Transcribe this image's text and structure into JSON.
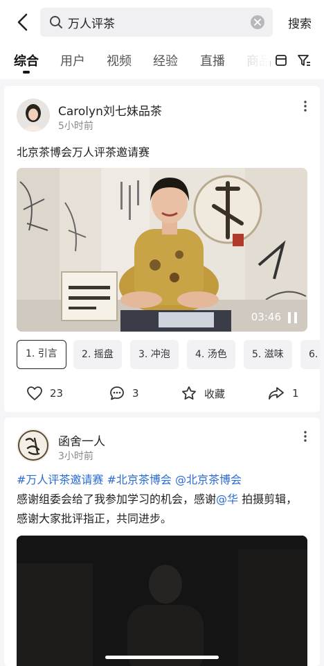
{
  "search": {
    "query": "万人评茶",
    "button": "搜索"
  },
  "tabs": [
    {
      "label": "综合"
    },
    {
      "label": "用户"
    },
    {
      "label": "视频"
    },
    {
      "label": "经验"
    },
    {
      "label": "直播"
    },
    {
      "label": "商品"
    }
  ],
  "post1": {
    "author": "Carolyn刘七妹品茶",
    "time": "5小时前",
    "title": "北京茶博会万人评茶邀请赛",
    "video_duration": "03:46",
    "chapters": [
      "1. 引言",
      "2. 摇盘",
      "3. 冲泡",
      "4. 汤色",
      "5. 滋味",
      "6."
    ],
    "likes": "23",
    "comments": "3",
    "favorite_label": "收藏",
    "shares": "1"
  },
  "post2": {
    "author": "函舍一人",
    "time": "3小时前",
    "tag1": "#万人评茶邀请赛",
    "tag2": "#北京茶博会",
    "mention1": "@北京茶博会",
    "text1": "感谢组委会给了我参加学习的机会，感谢",
    "mention2": "@华",
    "text2": "拍摄剪辑，感谢大家批评指正，共同进步。"
  },
  "colors": {
    "accent": "#2a6bd2",
    "text": "#222222",
    "muted": "#888888"
  }
}
